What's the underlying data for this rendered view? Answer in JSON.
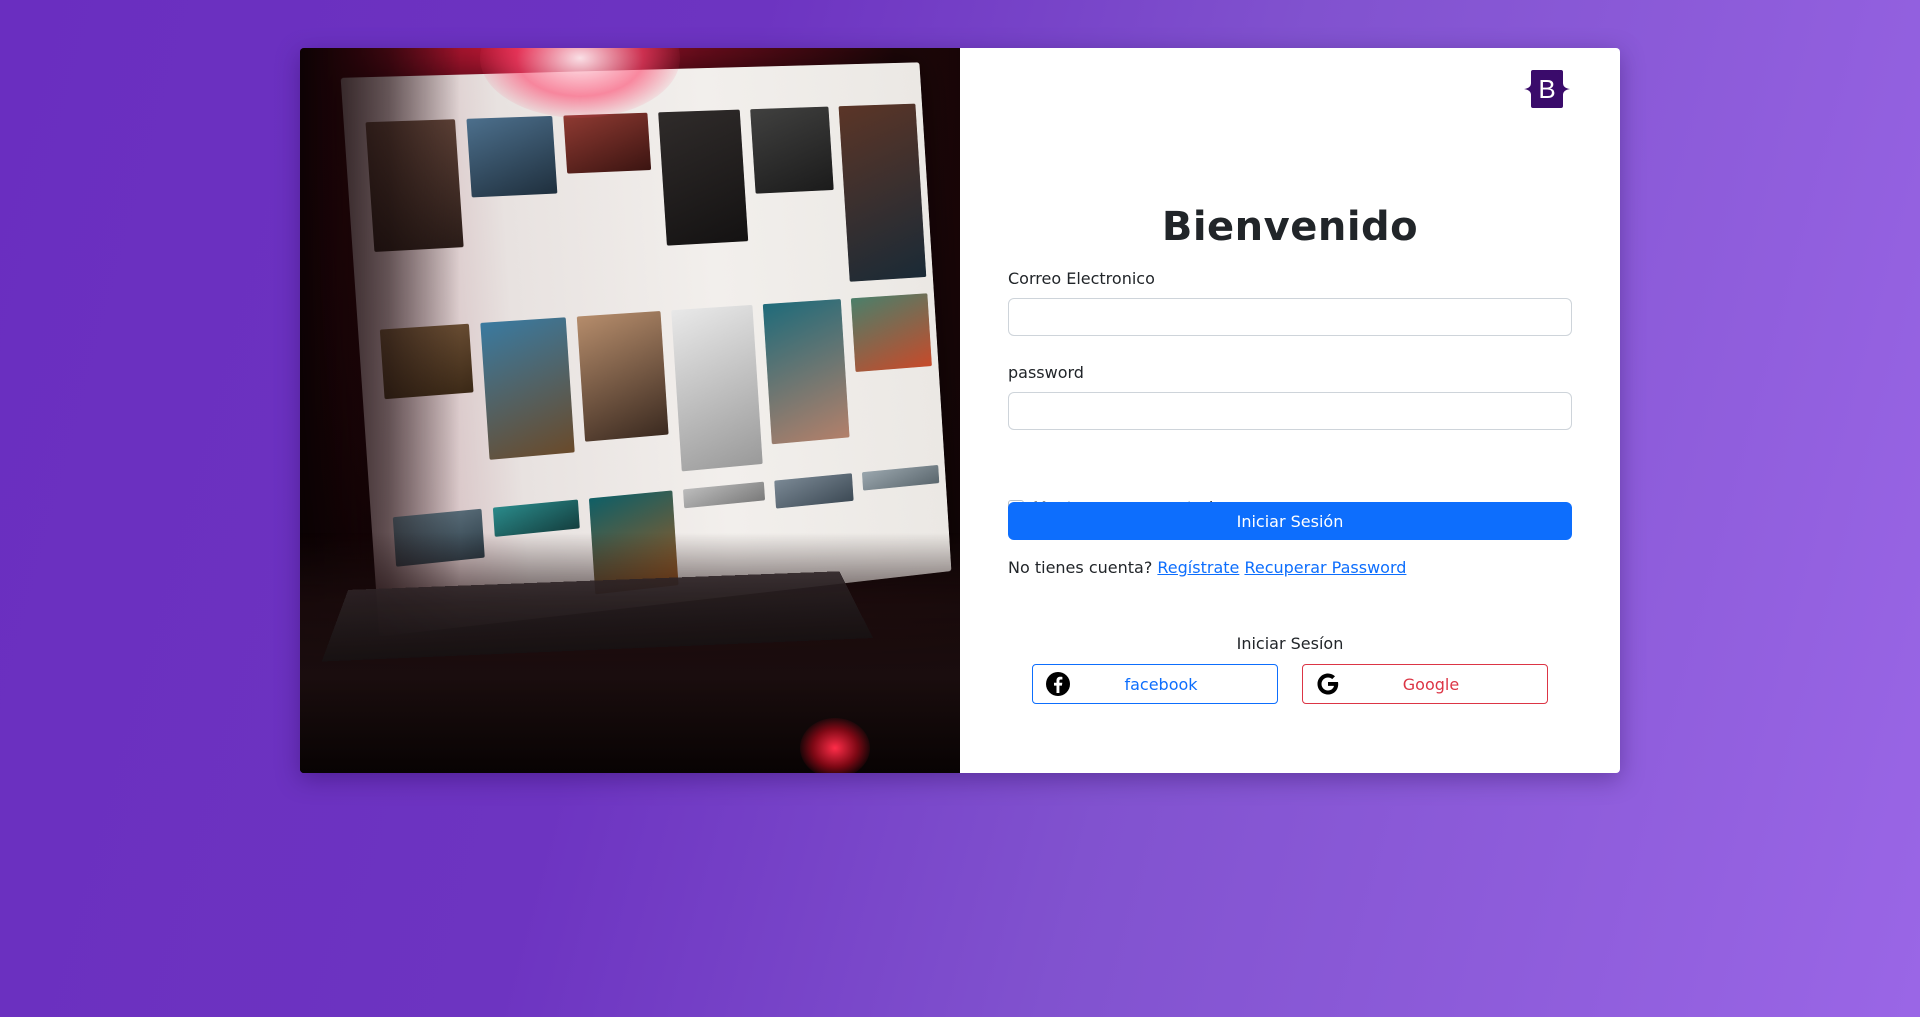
{
  "form": {
    "title": "Bienvenido",
    "email_label": "Correo Electronico",
    "email_value": "",
    "email_placeholder": "",
    "password_label": "password",
    "password_value": "",
    "password_placeholder": "",
    "remember_label": "Mantenerme conectado",
    "remember_checked": false,
    "submit_label": "Iniciar Sesión",
    "no_account_text": "No tienes cuenta?",
    "register_link": "Regístrate",
    "recover_link": "Recuperar Password"
  },
  "social": {
    "title": "Iniciar Sesíon",
    "facebook_label": "facebook",
    "google_label": "Google"
  },
  "logo": {
    "letter": "B",
    "color": "#3a0b6b"
  },
  "colors": {
    "primary": "#0d6efd",
    "danger": "#dc3545",
    "background_start": "#6a2ec0",
    "background_end": "#9a66e6"
  },
  "icons": [
    "bootstrap-logo-icon",
    "facebook-icon",
    "google-icon"
  ]
}
